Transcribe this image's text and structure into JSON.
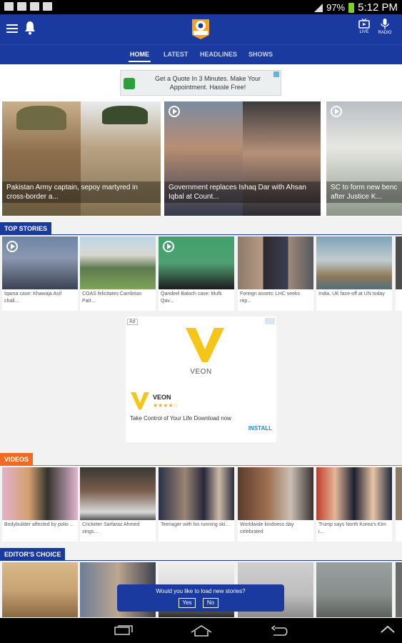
{
  "status_bar": {
    "battery": "97%",
    "time": "5:12 PM"
  },
  "header": {
    "live_label": "LIVE",
    "radio_label": "RADIO"
  },
  "tabs": [
    {
      "label": "HOME",
      "active": true
    },
    {
      "label": "LATEST",
      "active": false
    },
    {
      "label": "HEADLINES",
      "active": false
    },
    {
      "label": "SHOWS",
      "active": false
    }
  ],
  "top_ad": {
    "text": "Get a Quote In 3 Minutes. Make Your Appointment. Hassle Free!"
  },
  "hero": [
    {
      "caption": "Pakistan Army captain, sepoy martyred in cross-border a..."
    },
    {
      "caption": "Government replaces Ishaq Dar with Ahsan Iqbal at Count..."
    },
    {
      "caption": "SC to form new benc after Justice K..."
    }
  ],
  "sections": {
    "top_stories": "TOP STORIES",
    "videos": "VIDEOS",
    "editors_choice": "EDITOR'S CHOICE"
  },
  "top_stories": [
    {
      "text": "Iqama case: Khawaja Asif chall..."
    },
    {
      "text": "COAS felicitates Cambrian Patr..."
    },
    {
      "text": "Qandeel Baloch case: Mufti Qav..."
    },
    {
      "text": "Foreign assets: LHC seeks rep..."
    },
    {
      "text": "India, UK face-off at UN today"
    }
  ],
  "mid_ad": {
    "tag": "Ad",
    "brand": "VEON",
    "name": "VEON",
    "stars": "★★★★☆",
    "body": "Take Control of Your Life Download now",
    "cta": "INSTALL"
  },
  "videos": [
    {
      "text": "Bodybuilder affected by polio ..."
    },
    {
      "text": "Cricketer Sarfaraz Ahmed sings..."
    },
    {
      "text": "Teenager with his running ski..."
    },
    {
      "text": "Worldwide kindness day celebrated"
    },
    {
      "text": "Trump says North Korea's Kim i..."
    }
  ],
  "toast": {
    "message": "Would you like to load new stories?",
    "yes": "Yes",
    "no": "No"
  },
  "colors": {
    "brand_blue": "#1a3aa0",
    "videos_orange": "#f26a21",
    "install_blue": "#1a8ad8"
  }
}
